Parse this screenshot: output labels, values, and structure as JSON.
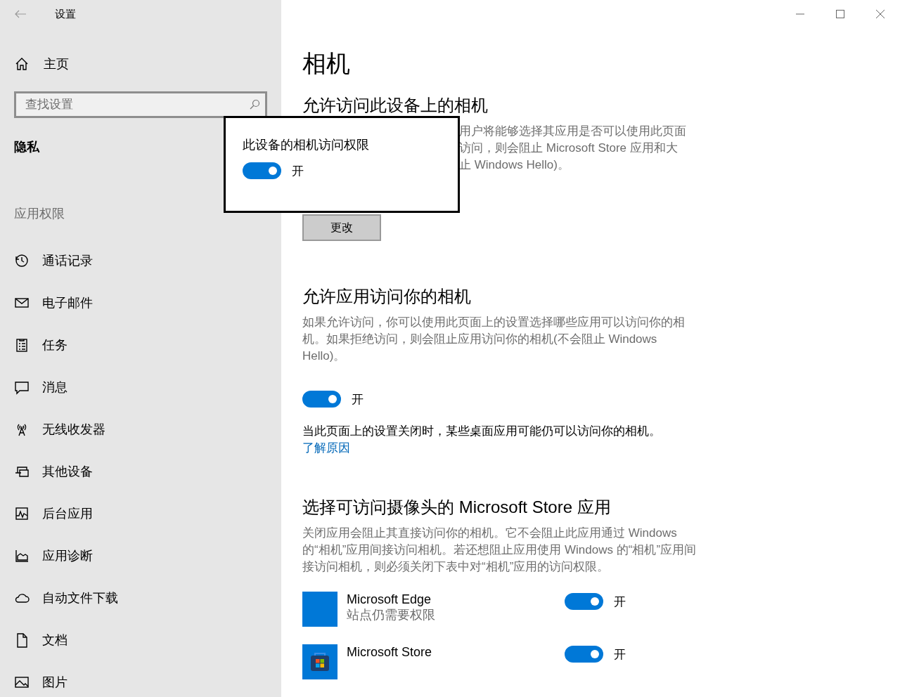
{
  "window": {
    "title": "设置"
  },
  "sidebar": {
    "home": "主页",
    "search": {
      "placeholder": "查找设置"
    },
    "section": "隐私",
    "group": "应用权限",
    "items": [
      {
        "label": "通话记录",
        "kind": "history"
      },
      {
        "label": "电子邮件",
        "kind": "mail"
      },
      {
        "label": "任务",
        "kind": "tasks"
      },
      {
        "label": "消息",
        "kind": "message"
      },
      {
        "label": "无线收发器",
        "kind": "radio"
      },
      {
        "label": "其他设备",
        "kind": "devices"
      },
      {
        "label": "后台应用",
        "kind": "background"
      },
      {
        "label": "应用诊断",
        "kind": "diagnostics"
      },
      {
        "label": "自动文件下载",
        "kind": "cloud"
      },
      {
        "label": "文档",
        "kind": "document"
      },
      {
        "label": "图片",
        "kind": "picture"
      }
    ]
  },
  "page": {
    "title": "相机"
  },
  "device_access": {
    "heading": "允许访问此设备上的相机",
    "description_fragments": [
      "用户将能够选择其应用是否可以使用此页面",
      "访问，则会阻止 Microsoft Store 应用和大",
      "止 Windows Hello)。"
    ],
    "button": "更改"
  },
  "popup": {
    "title": "此设备的相机访问权限",
    "toggle": {
      "on": true,
      "label": "开"
    }
  },
  "app_access": {
    "heading": "允许应用访问你的相机",
    "description": "如果允许访问，你可以使用此页面上的设置选择哪些应用可以访问你的相机。如果拒绝访问，则会阻止应用访问你的相机(不会阻止 Windows Hello)。",
    "toggle": {
      "on": true,
      "label": "开"
    },
    "note": "当此页面上的设置关闭时，某些桌面应用可能仍可以访问你的相机。",
    "link": "了解原因"
  },
  "store_apps": {
    "heading": "选择可访问摄像头的 Microsoft Store 应用",
    "description": "关闭应用会阻止其直接访问你的相机。它不会阻止此应用通过 Windows 的“相机”应用间接访问相机。若还想阻止应用使用 Windows 的“相机”应用间接访问相机，则必须关闭下表中对“相机”应用的访问权限。",
    "apps": [
      {
        "name": "Microsoft Edge",
        "subtitle": "站点仍需要权限",
        "kind": "blank",
        "toggle": {
          "on": true,
          "label": "开"
        }
      },
      {
        "name": "Microsoft Store",
        "kind": "store",
        "toggle": {
          "on": true,
          "label": "开"
        }
      }
    ]
  }
}
